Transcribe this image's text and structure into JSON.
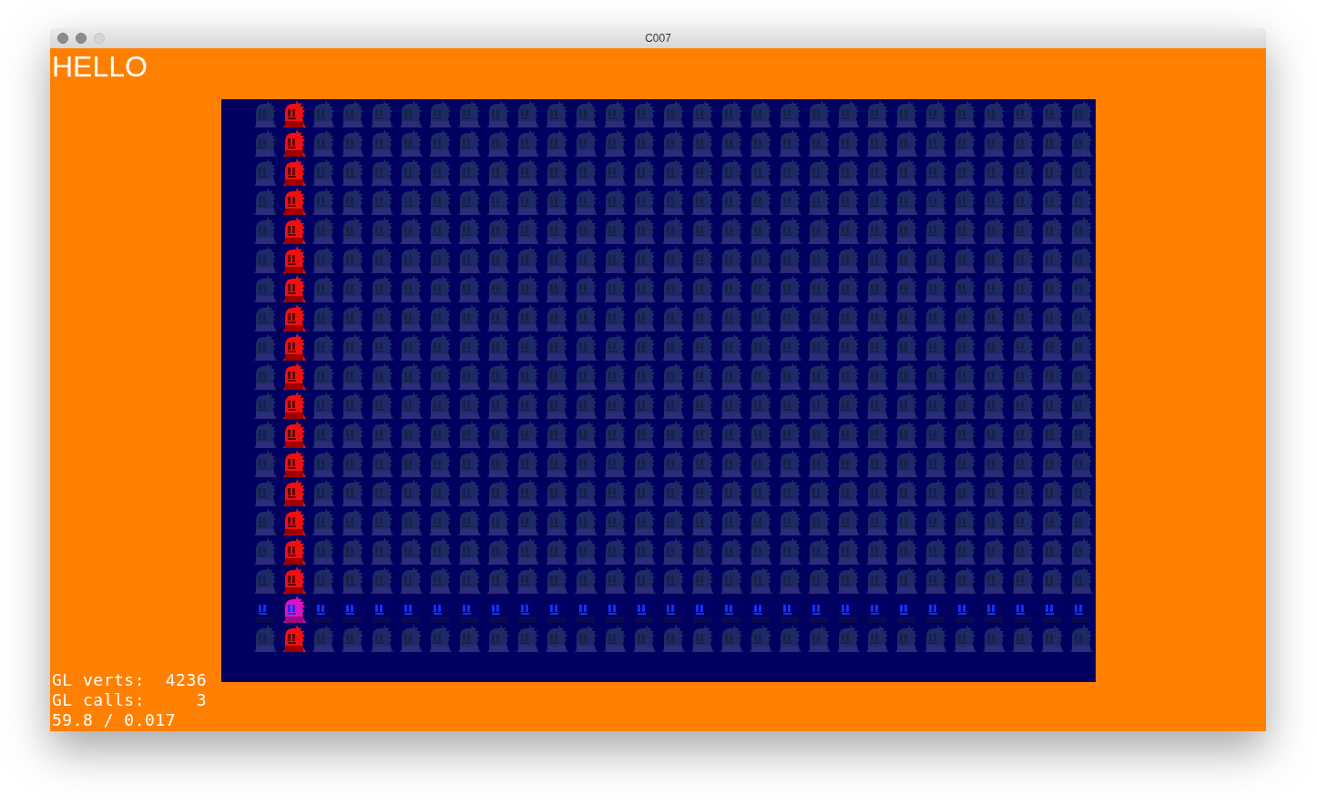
{
  "window": {
    "title": "C007"
  },
  "heading": "HELLO",
  "stats": [
    "GL verts:  4236",
    "GL calls:     3",
    "59.8 / 0.017"
  ]
}
